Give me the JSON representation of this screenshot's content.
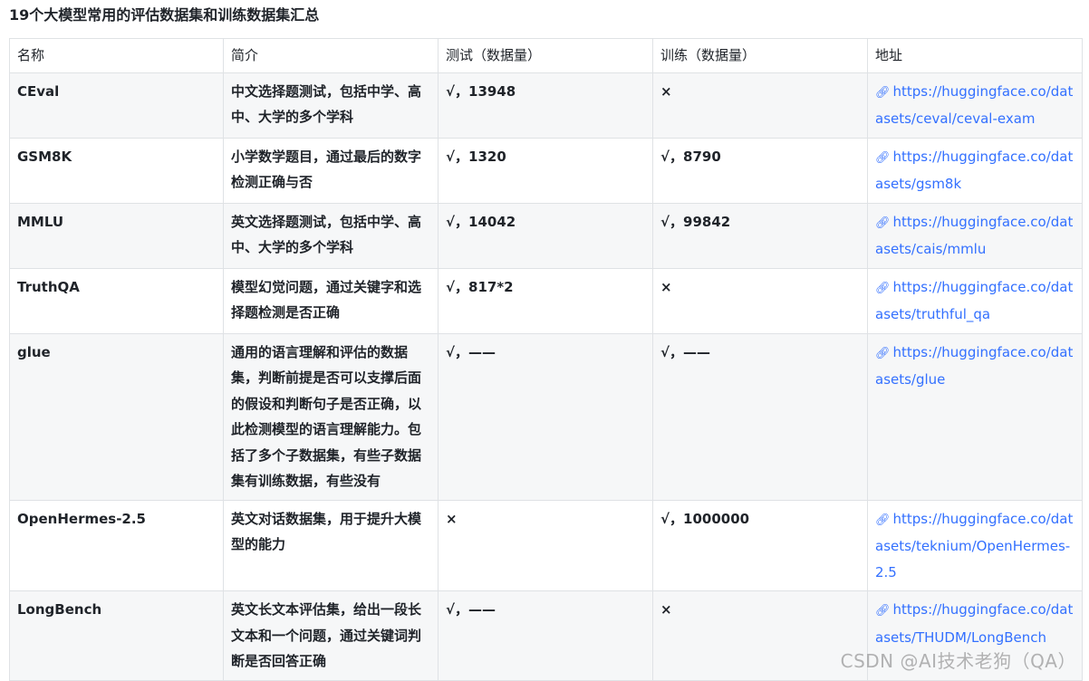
{
  "page_title": "19个大模型常用的评估数据集和训练数据集汇总",
  "table": {
    "headers": [
      "名称",
      "简介",
      "测试（数据量）",
      "训练（数据量）",
      "地址"
    ],
    "rows": [
      {
        "name": "CEval",
        "desc": "中文选择题测试，包括中学、高中、大学的多个学科",
        "test": "√，13948",
        "train": "×",
        "url": "https://huggingface.co/datasets/ceval/ceval-exam"
      },
      {
        "name": "GSM8K",
        "desc": "小学数学题目，通过最后的数字检测正确与否",
        "test": "√，1320",
        "train": "√，8790",
        "url": "https://huggingface.co/datasets/gsm8k"
      },
      {
        "name": "MMLU",
        "desc": "英文选择题测试，包括中学、高中、大学的多个学科",
        "test": "√，14042",
        "train": "√，99842",
        "url": "https://huggingface.co/datasets/cais/mmlu"
      },
      {
        "name": "TruthQA",
        "desc": "模型幻觉问题，通过关键字和选择题检测是否正确",
        "test": "√，817*2",
        "train": "×",
        "url": "https://huggingface.co/datasets/truthful_qa"
      },
      {
        "name": "glue",
        "desc": "通用的语言理解和评估的数据集，判断前提是否可以支撑后面的假设和判断句子是否正确，以此检测模型的语言理解能力。包括了多个子数据集，有些子数据集有训练数据，有些没有",
        "test": "√，——",
        "train": "√，——",
        "url": "https://huggingface.co/datasets/glue"
      },
      {
        "name": "OpenHermes-2.5",
        "desc": "英文对话数据集，用于提升大模型的能力",
        "test": "×",
        "train": "√，1000000",
        "url": "https://huggingface.co/datasets/teknium/OpenHermes-2.5"
      },
      {
        "name": "LongBench",
        "desc": "英文长文本评估集，给出一段长文本和一个问题，通过关键词判断是否回答正确",
        "test": "√，——",
        "train": "×",
        "url": "https://huggingface.co/datasets/THUDM/LongBench"
      }
    ]
  },
  "link_icon": "link-icon",
  "watermark": "CSDN @AI技术老狗（QA）"
}
